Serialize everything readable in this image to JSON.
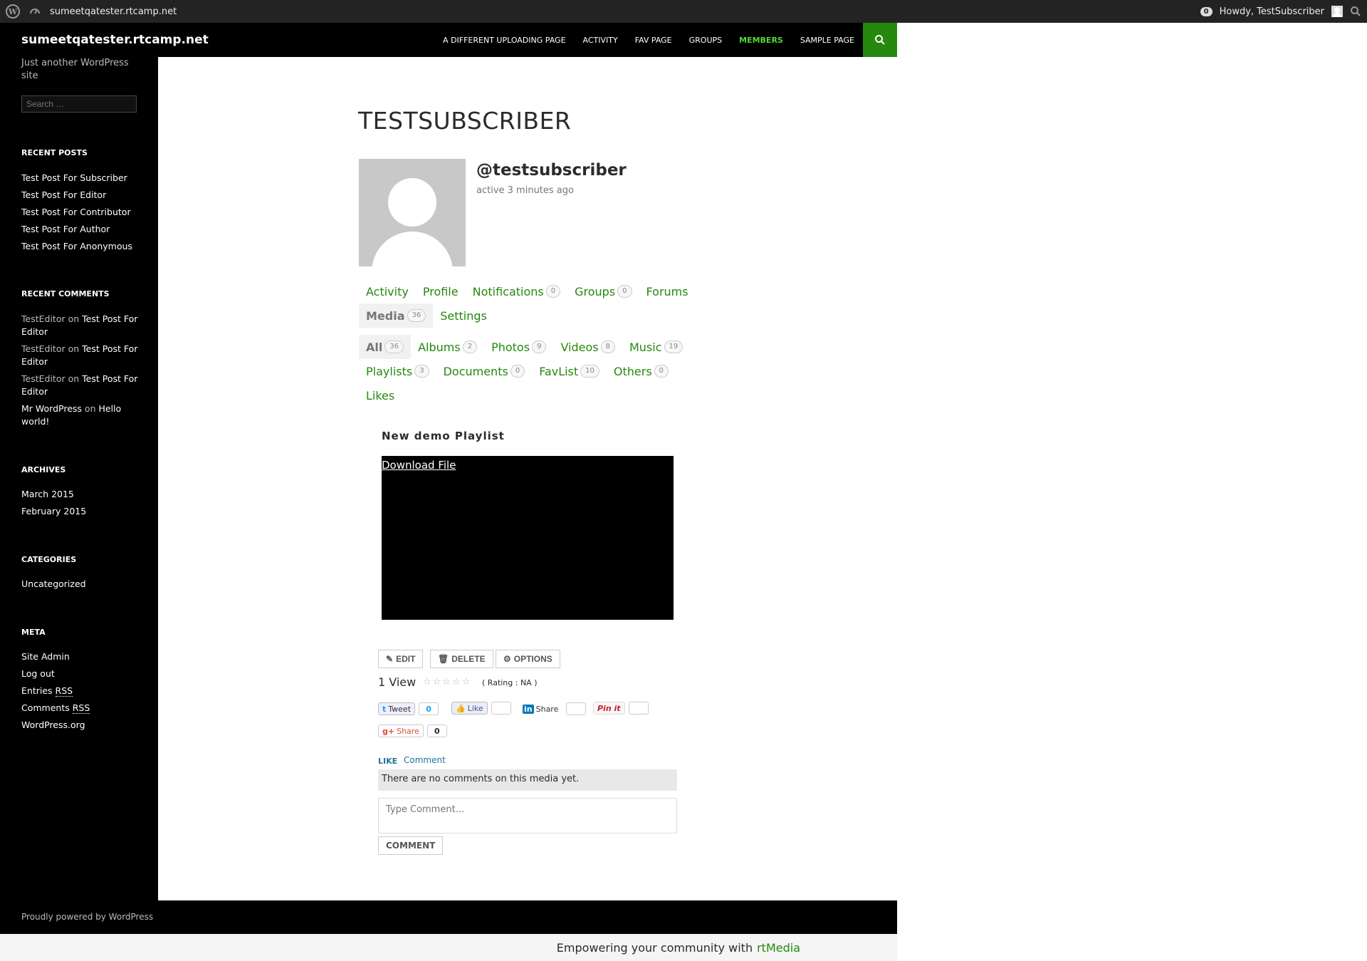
{
  "adminbar": {
    "site": "sumeetqatester.rtcamp.net",
    "notifications": "0",
    "howdy": "Howdy, TestSubscriber"
  },
  "site": {
    "title": "sumeetqatester.rtcamp.net",
    "tagline": "Just another WordPress site",
    "search_placeholder": "Search …"
  },
  "nav": {
    "items": [
      "A DIFFERENT UPLOADING PAGE",
      "ACTIVITY",
      "FAV PAGE",
      "GROUPS",
      "MEMBERS",
      "SAMPLE PAGE"
    ],
    "current": "MEMBERS",
    "accent": "#24890d"
  },
  "widgets": {
    "recent_posts": {
      "title": "RECENT POSTS",
      "items": [
        "Test Post For Subscriber",
        "Test Post For Editor",
        "Test Post For Contributor",
        "Test Post For Author",
        "Test Post For Anonymous"
      ]
    },
    "recent_comments": {
      "title": "RECENT COMMENTS",
      "items": [
        {
          "author": "TestEditor",
          "on": "on",
          "post": "Test Post For Editor"
        },
        {
          "author": "TestEditor",
          "on": "on",
          "post": "Test Post For Editor"
        },
        {
          "author": "TestEditor",
          "on": "on",
          "post": "Test Post For Editor"
        },
        {
          "author": "Mr WordPress",
          "on": "on",
          "post": "Hello world!"
        }
      ]
    },
    "archives": {
      "title": "ARCHIVES",
      "items": [
        "March 2015",
        "February 2015"
      ]
    },
    "categories": {
      "title": "CATEGORIES",
      "items": [
        "Uncategorized"
      ]
    },
    "meta": {
      "title": "META",
      "items": [
        "Site Admin",
        "Log out",
        "Entries",
        "Comments",
        "WordPress.org"
      ],
      "rss": "RSS"
    }
  },
  "profile": {
    "page_title": "TESTSUBSCRIBER",
    "handle": "@testsubscriber",
    "active": "active 3 minutes ago"
  },
  "tabs": {
    "primary_row1": [
      {
        "label": "Activity",
        "count": ""
      },
      {
        "label": "Profile",
        "count": ""
      },
      {
        "label": "Notifications",
        "count": "0"
      },
      {
        "label": "Groups",
        "count": "0"
      },
      {
        "label": "Forums",
        "count": ""
      }
    ],
    "primary_row2": [
      {
        "label": "Media",
        "count": "36",
        "current": true
      },
      {
        "label": "Settings",
        "count": ""
      }
    ],
    "media_row1": [
      {
        "label": "All",
        "count": "36",
        "current": true
      },
      {
        "label": "Albums",
        "count": "2"
      },
      {
        "label": "Photos",
        "count": "9"
      },
      {
        "label": "Videos",
        "count": "8"
      },
      {
        "label": "Music",
        "count": "19"
      }
    ],
    "media_row2": [
      {
        "label": "Playlists",
        "count": "3"
      },
      {
        "label": "Documents",
        "count": "0"
      },
      {
        "label": "FavList",
        "count": "10"
      },
      {
        "label": "Others",
        "count": "0"
      }
    ],
    "media_row3": [
      {
        "label": "Likes",
        "count": ""
      }
    ]
  },
  "media": {
    "title": "New demo Playlist",
    "download": "Download File",
    "edit": "EDIT",
    "delete": "DELETE",
    "options": "OPTIONS",
    "views": "1 View",
    "stars": "☆☆☆☆☆",
    "rating": "( Rating : NA )"
  },
  "social": {
    "tweet": "Tweet",
    "tweet_count": "0",
    "like": "Like",
    "share_in": "Share",
    "pin": "Pin it",
    "gplus": "Share",
    "gplus_count": "0"
  },
  "comments": {
    "like": "LIKE",
    "comment": "Comment",
    "empty": "There are no comments on this media yet.",
    "placeholder": "Type Comment...",
    "submit": "COMMENT"
  },
  "footer": {
    "credit": "Proudly powered by WordPress",
    "rtmedia_text": "Empowering your community with",
    "rtmedia_brand": "rtMedia"
  }
}
